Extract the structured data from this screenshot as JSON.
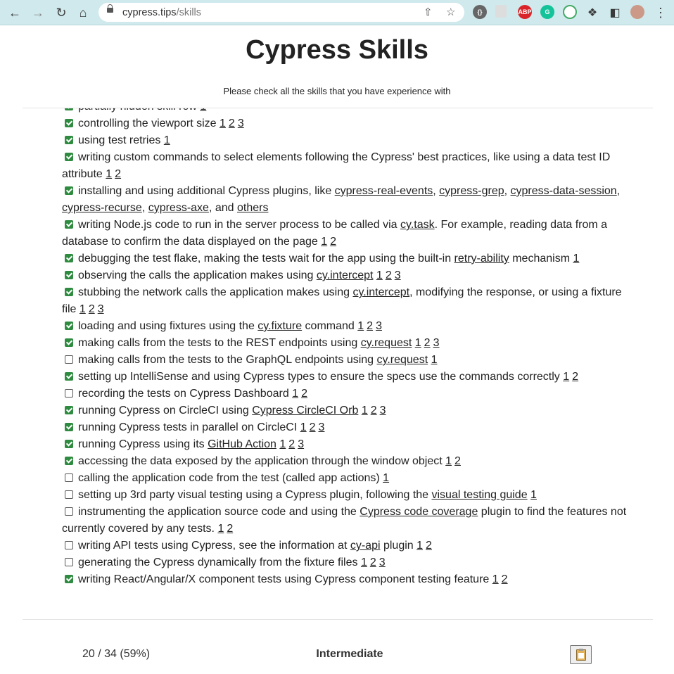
{
  "browser": {
    "url_host": "cypress.tips",
    "url_path": "/skills",
    "nav": [
      "back-arrow",
      "forward-arrow",
      "reload",
      "home"
    ]
  },
  "header": {
    "title": "Cypress Skills",
    "subtitle": "Please check all the skills that you have experience with"
  },
  "skills": [
    {
      "checked": true,
      "parts": [
        {
          "t": "partially hidden skill row"
        }
      ],
      "refs": [
        "1"
      ]
    },
    {
      "checked": true,
      "parts": [
        {
          "t": "controlling the viewport size"
        }
      ],
      "refs": [
        "1",
        "2",
        "3"
      ]
    },
    {
      "checked": true,
      "parts": [
        {
          "t": "using test retries"
        }
      ],
      "refs": [
        "1"
      ]
    },
    {
      "checked": true,
      "parts": [
        {
          "t": "writing custom commands to select elements following the Cypress' best practices, like using a data test ID attribute"
        }
      ],
      "refs": [
        "1",
        "2"
      ]
    },
    {
      "checked": true,
      "parts": [
        {
          "t": "installing and using additional Cypress plugins, like "
        },
        {
          "l": "cypress-real-events"
        },
        {
          "t": ", "
        },
        {
          "l": "cypress-grep"
        },
        {
          "t": ", "
        },
        {
          "l": "cypress-data-session"
        },
        {
          "t": ", "
        },
        {
          "l": "cypress-recurse"
        },
        {
          "t": ", "
        },
        {
          "l": "cypress-axe"
        },
        {
          "t": ", and "
        },
        {
          "l": "others"
        }
      ],
      "refs": []
    },
    {
      "checked": true,
      "parts": [
        {
          "t": "writing Node.js code to run in the server process to be called via "
        },
        {
          "l": "cy.task"
        },
        {
          "t": ". For example, reading data from a database to confirm the data displayed on the page"
        }
      ],
      "refs": [
        "1",
        "2"
      ]
    },
    {
      "checked": true,
      "parts": [
        {
          "t": "debugging the test flake, making the tests wait for the app using the built-in "
        },
        {
          "l": "retry-ability"
        },
        {
          "t": " mechanism"
        }
      ],
      "refs": [
        "1"
      ]
    },
    {
      "checked": true,
      "parts": [
        {
          "t": "observing the calls the application makes using "
        },
        {
          "l": "cy.intercept"
        }
      ],
      "refs": [
        "1",
        "2",
        "3"
      ]
    },
    {
      "checked": true,
      "parts": [
        {
          "t": "stubbing the network calls the application makes using "
        },
        {
          "l": "cy.intercept"
        },
        {
          "t": ", modifying the response, or using a fixture file"
        }
      ],
      "refs": [
        "1",
        "2",
        "3"
      ]
    },
    {
      "checked": true,
      "parts": [
        {
          "t": "loading and using fixtures using the "
        },
        {
          "l": "cy.fixture"
        },
        {
          "t": " command"
        }
      ],
      "refs": [
        "1",
        "2",
        "3"
      ]
    },
    {
      "checked": true,
      "parts": [
        {
          "t": "making calls from the tests to the REST endpoints using "
        },
        {
          "l": "cy.request"
        }
      ],
      "refs": [
        "1",
        "2",
        "3"
      ]
    },
    {
      "checked": false,
      "parts": [
        {
          "t": "making calls from the tests to the GraphQL endpoints using "
        },
        {
          "l": "cy.request"
        }
      ],
      "refs": [
        "1"
      ]
    },
    {
      "checked": true,
      "parts": [
        {
          "t": "setting up IntelliSense and using Cypress types to ensure the specs use the commands correctly"
        }
      ],
      "refs": [
        "1",
        "2"
      ]
    },
    {
      "checked": false,
      "parts": [
        {
          "t": "recording the tests on Cypress Dashboard"
        }
      ],
      "refs": [
        "1",
        "2"
      ]
    },
    {
      "checked": true,
      "parts": [
        {
          "t": "running Cypress on CircleCI using "
        },
        {
          "l": "Cypress CircleCI Orb"
        }
      ],
      "refs": [
        "1",
        "2",
        "3"
      ]
    },
    {
      "checked": true,
      "parts": [
        {
          "t": "running Cypress tests in parallel on CircleCI"
        }
      ],
      "refs": [
        "1",
        "2",
        "3"
      ]
    },
    {
      "checked": true,
      "parts": [
        {
          "t": "running Cypress using its "
        },
        {
          "l": "GitHub Action"
        }
      ],
      "refs": [
        "1",
        "2",
        "3"
      ]
    },
    {
      "checked": true,
      "parts": [
        {
          "t": "accessing the data exposed by the application through the window object"
        }
      ],
      "refs": [
        "1",
        "2"
      ]
    },
    {
      "checked": false,
      "parts": [
        {
          "t": "calling the application code from the test (called app actions)"
        }
      ],
      "refs": [
        "1"
      ]
    },
    {
      "checked": false,
      "parts": [
        {
          "t": "setting up 3rd party visual testing using a Cypress plugin, following the "
        },
        {
          "l": "visual testing guide"
        }
      ],
      "refs": [
        "1"
      ]
    },
    {
      "checked": false,
      "parts": [
        {
          "t": "instrumenting the application source code and using the "
        },
        {
          "l": "Cypress code coverage"
        },
        {
          "t": " plugin to find the features not currently covered by any tests."
        }
      ],
      "refs": [
        "1",
        "2"
      ]
    },
    {
      "checked": false,
      "parts": [
        {
          "t": "writing API tests using Cypress, see the information at "
        },
        {
          "l": "cy-api"
        },
        {
          "t": " plugin"
        }
      ],
      "refs": [
        "1",
        "2"
      ]
    },
    {
      "checked": false,
      "parts": [
        {
          "t": "generating the Cypress dynamically from the fixture files"
        }
      ],
      "refs": [
        "1",
        "2",
        "3"
      ]
    },
    {
      "checked": true,
      "parts": [
        {
          "t": "writing React/Angular/X component tests using Cypress component testing feature"
        }
      ],
      "refs": [
        "1",
        "2"
      ]
    }
  ],
  "footer": {
    "count": "20 / 34 (59%)",
    "level": "Intermediate",
    "copy_icon": "clipboard-icon"
  }
}
